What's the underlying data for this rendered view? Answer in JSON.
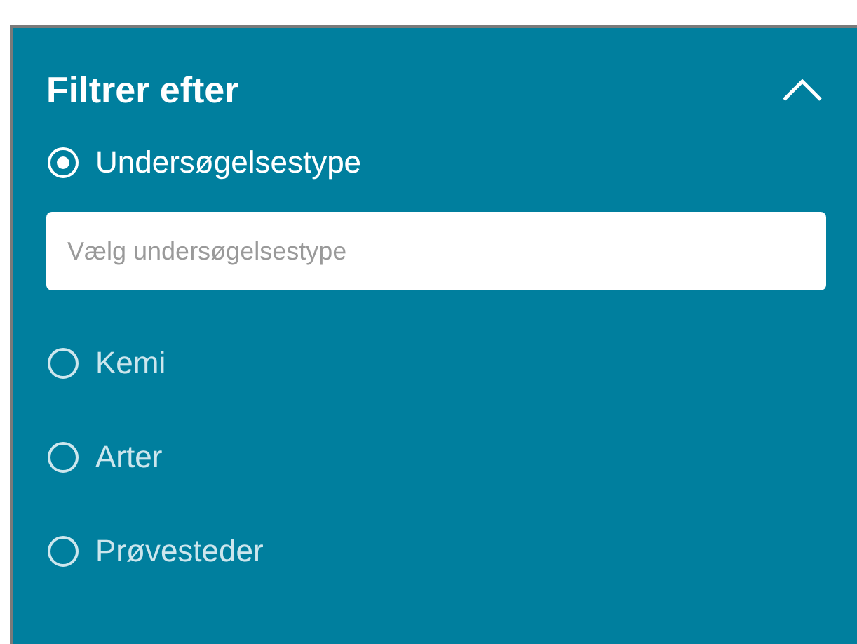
{
  "panel": {
    "title": "Filtrer efter",
    "expanded": true
  },
  "options": [
    {
      "label": "Undersøgelsestype",
      "selected": true,
      "placeholder": "Vælg undersøgelsestype"
    },
    {
      "label": "Kemi",
      "selected": false
    },
    {
      "label": "Arter",
      "selected": false
    },
    {
      "label": "Prøvesteder",
      "selected": false
    }
  ]
}
